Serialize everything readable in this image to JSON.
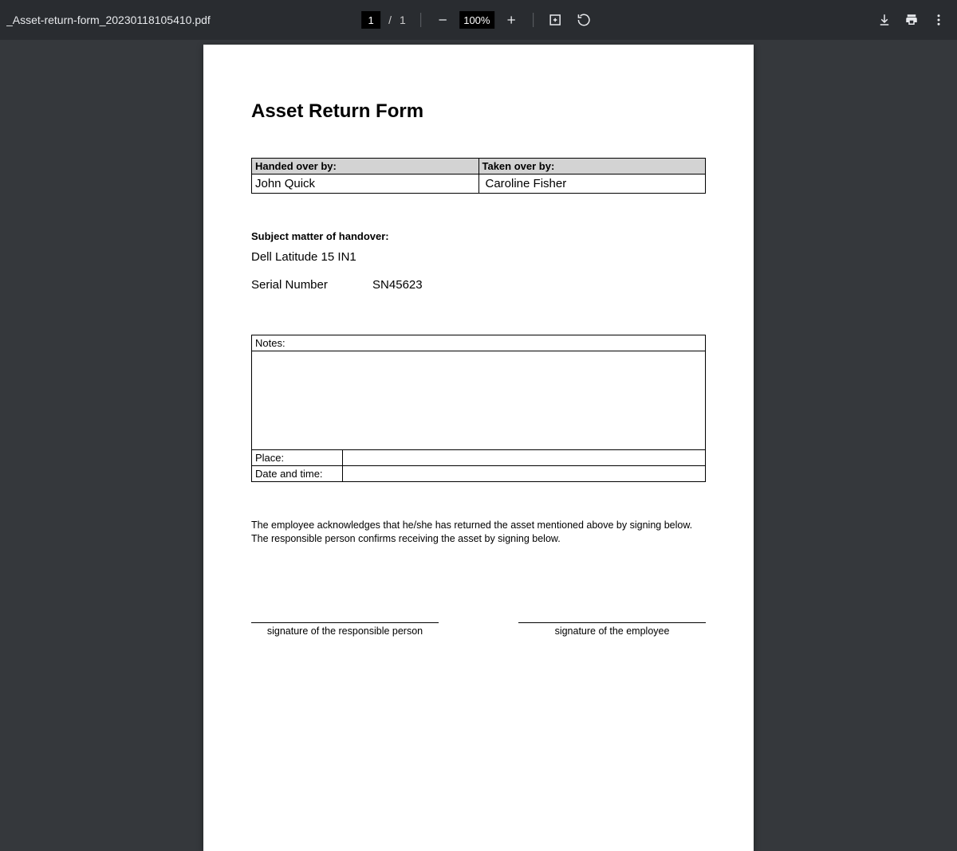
{
  "toolbar": {
    "filename": "_Asset-return-form_20230118105410.pdf",
    "page_current": "1",
    "page_total": "1",
    "zoom": "100%"
  },
  "doc": {
    "title": "Asset Return Form",
    "handed_over_by_label": "Handed over by:",
    "taken_over_by_label": "Taken over by:",
    "handed_over_by": "John Quick",
    "taken_over_by": "Caroline Fisher",
    "subject_label": "Subject matter of handover:",
    "asset_name": "Dell Latitude 15 IN1",
    "serial_label": "Serial Number",
    "serial_value": "SN45623",
    "notes_label": "Notes:",
    "place_label": "Place:",
    "date_label": "Date and time:",
    "ack_text": "The employee acknowledges that he/she has returned the asset mentioned above by signing below. The responsible person confirms receiving the asset by signing below.",
    "sig_left": "signature of the responsible person",
    "sig_right": "signature of the employee"
  }
}
